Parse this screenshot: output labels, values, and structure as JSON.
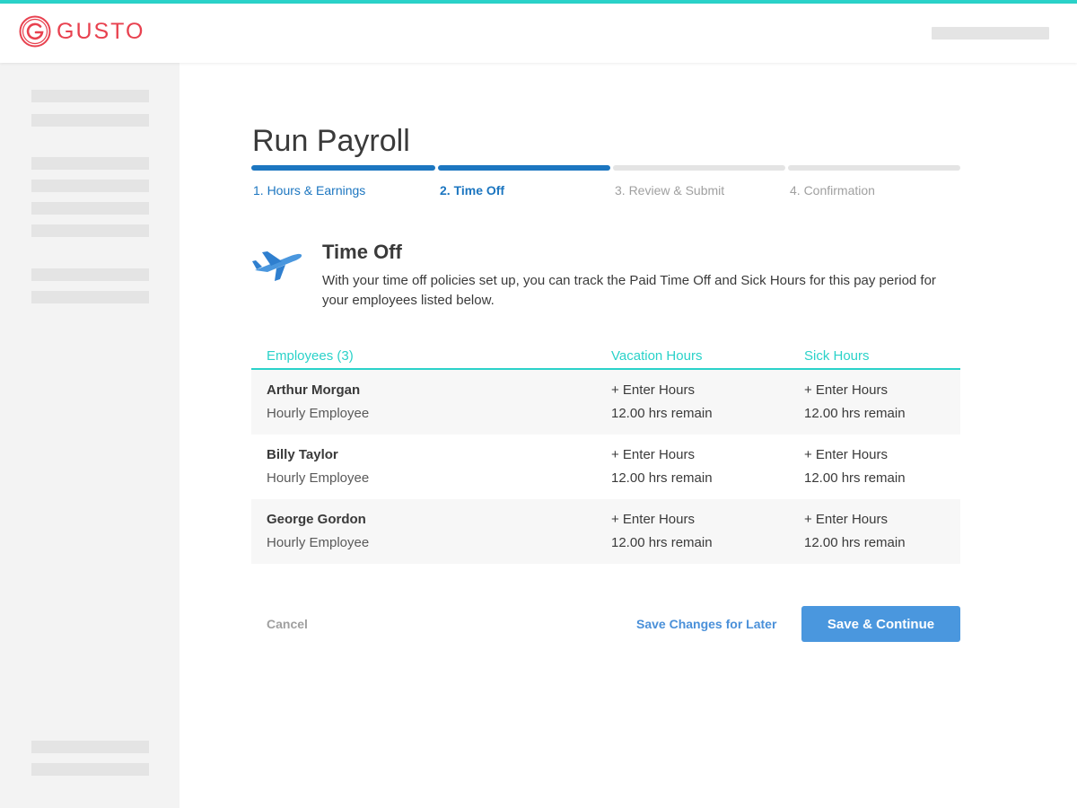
{
  "header": {
    "logo_text": "GUSTO",
    "logo_icon": "gusto-logo-icon"
  },
  "colors": {
    "accent_teal": "#2ad2c9",
    "brand_red": "#e8414f",
    "progress_blue": "#1c76c0",
    "button_blue": "#4a97de"
  },
  "page": {
    "title": "Run Payroll"
  },
  "steps": [
    {
      "label": "1. Hours & Earnings",
      "state": "done"
    },
    {
      "label": "2. Time Off",
      "state": "active"
    },
    {
      "label": "3. Review & Submit",
      "state": "pending"
    },
    {
      "label": "4. Confirmation",
      "state": "pending"
    }
  ],
  "section": {
    "icon": "airplane-icon",
    "title": "Time Off",
    "description": "With your time off policies set up, you can track the Paid Time Off and Sick Hours for this pay period for your employees listed below."
  },
  "table": {
    "headers": {
      "employees": "Employees (3)",
      "vacation": "Vacation Hours",
      "sick": "Sick Hours"
    },
    "rows": [
      {
        "name": "Arthur Morgan",
        "type": "Hourly Employee",
        "vacation_action": "+ Enter Hours",
        "vacation_remain": "12.00 hrs remain",
        "sick_action": "+ Enter Hours",
        "sick_remain": "12.00 hrs remain"
      },
      {
        "name": "Billy Taylor",
        "type": "Hourly Employee",
        "vacation_action": "+ Enter Hours",
        "vacation_remain": "12.00 hrs remain",
        "sick_action": "+ Enter Hours",
        "sick_remain": "12.00 hrs remain"
      },
      {
        "name": "George Gordon",
        "type": "Hourly Employee",
        "vacation_action": "+ Enter Hours",
        "vacation_remain": "12.00 hrs remain",
        "sick_action": "+ Enter Hours",
        "sick_remain": "12.00 hrs remain"
      }
    ]
  },
  "footer": {
    "cancel_label": "Cancel",
    "save_later_label": "Save Changes for Later",
    "save_continue_label": "Save & Continue"
  }
}
